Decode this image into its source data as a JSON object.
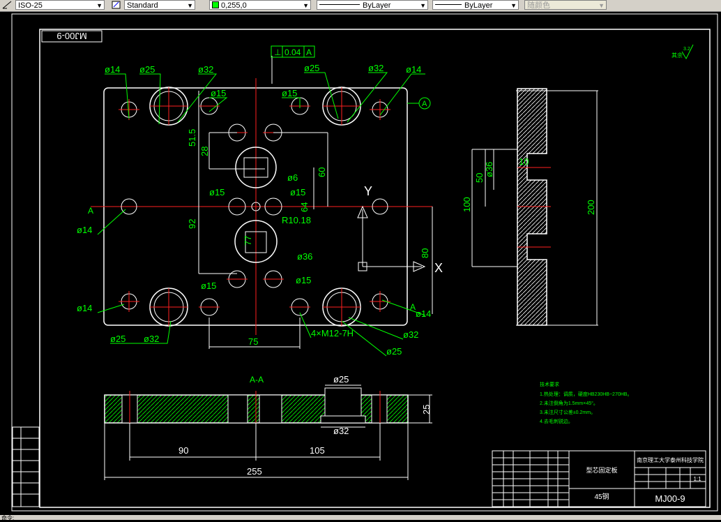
{
  "toolbar": {
    "dimstyle": "ISO-25",
    "textstyle": "Standard",
    "color": "0,255,0",
    "linetype": "ByLayer",
    "lineweight": "ByLayer",
    "plotstyle": "随颜色"
  },
  "drawing": {
    "title_block_mirrored": "MJ00-9",
    "flatness": "0.04",
    "flatness_datum": "A",
    "section_marker": "A",
    "roughness": "3.2",
    "roughness_label": "其余",
    "dims_top": {
      "d14_tl": "ø14",
      "d25_tl": "ø25",
      "d32_tl": "ø32",
      "d25_tr": "ø25",
      "d32_tr": "ø32",
      "d14_tr": "ø14",
      "d15_l": "ø15",
      "d15_r": "ø15",
      "v515": "51.5",
      "v28": "28",
      "v60": "60",
      "d6": "ø6",
      "d15_ml": "ø15",
      "d15_mr": "ø15",
      "v64": "64",
      "d14_ml": "ø14",
      "v92": "92",
      "r1018": "R10.18",
      "v77": "77",
      "d36": "ø36",
      "v80": "80",
      "d15_bl": "ø15",
      "d15_br": "ø15",
      "d14_bl": "ø14",
      "d14_br": "ø14",
      "d25_bl": "ø25",
      "d32_bl": "ø32",
      "m12": "4×M12-7H",
      "d32_br": "ø32",
      "d25_br": "ø25",
      "v75": "75",
      "axis_y": "Y",
      "axis_x": "X"
    },
    "dims_side": {
      "v10": "10",
      "v50": "50",
      "d36": "ø36",
      "v100": "100",
      "v200": "200"
    },
    "section": {
      "title": "A-A",
      "d25": "ø25",
      "d32": "ø32",
      "v25": "25",
      "v90": "90",
      "v105": "105",
      "v255": "255"
    },
    "notes": {
      "heading": "技术要求",
      "lines": [
        "1.热处理：调质，硬度HB230HB~270HB。",
        "2.未注倒角为1.5mm×45°。",
        "3.未注尺寸公差±0.2mm。",
        "4.去毛刺锐边。"
      ]
    },
    "title_block": {
      "part_name": "型芯固定板",
      "school": "南京理工大学泰州科技学院",
      "material": "45钢",
      "scale": "1:1",
      "drawing_no": "MJ00-9"
    }
  },
  "status": {
    "command": "命令:"
  }
}
